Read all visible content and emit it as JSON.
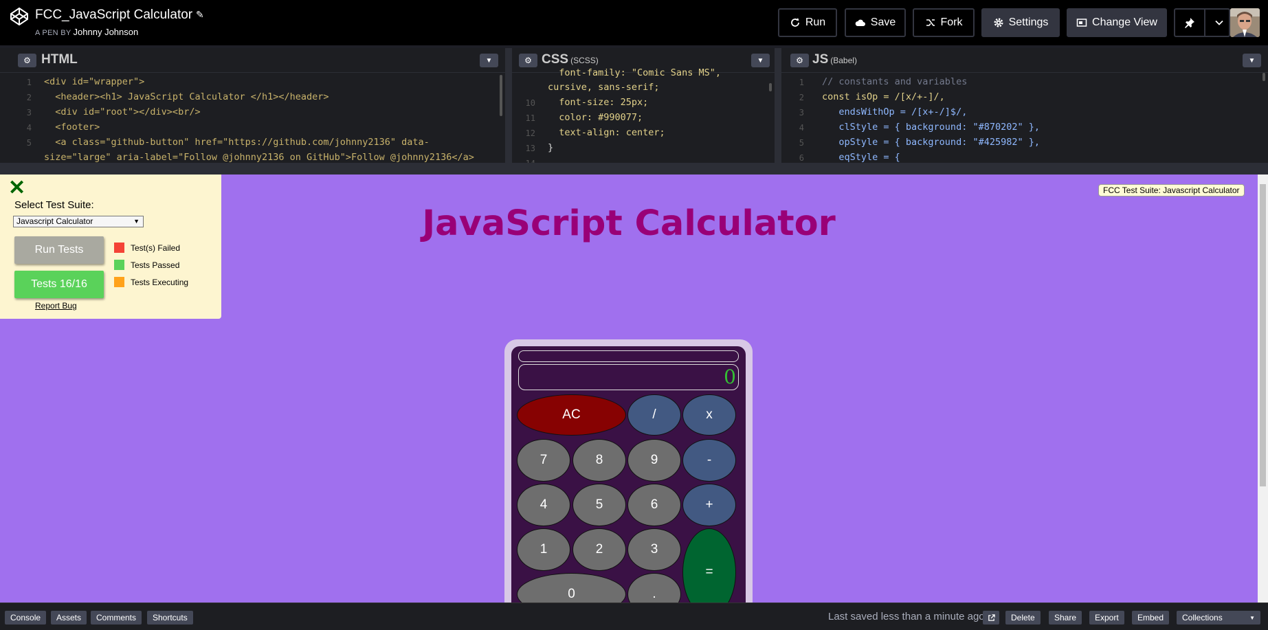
{
  "header": {
    "pen_title": "FCC_JavaScript Calculator",
    "pen_by_label": "A PEN BY",
    "author": "Johnny Johnson",
    "buttons": {
      "run": "Run",
      "save": "Save",
      "fork": "Fork",
      "settings": "Settings",
      "change_view": "Change View"
    }
  },
  "editors": {
    "html": {
      "title": "HTML",
      "subtitle": ""
    },
    "css": {
      "title": "CSS",
      "subtitle": "(SCSS)"
    },
    "js": {
      "title": "JS",
      "subtitle": "(Babel)"
    }
  },
  "code": {
    "html_lines": [
      {
        "n": "1",
        "text": "<div id=\"wrapper\">"
      },
      {
        "n": "2",
        "text": "  <header><h1> JavaScript Calculator </h1></header>"
      },
      {
        "n": "3",
        "text": "  <div id=\"root\"></div><br/>"
      },
      {
        "n": "4",
        "text": "  <footer>"
      },
      {
        "n": "5",
        "text": "  <a class=\"github-button\" href=\"https://github.com/johnny2136\" data-"
      },
      {
        "n": "",
        "text": "size=\"large\" aria-label=\"Follow @johnny2136 on GitHub\">Follow @johnny2136</a>"
      }
    ],
    "css_lines": [
      {
        "n": "",
        "text": "  font-family: \"Comic Sans MS\","
      },
      {
        "n": "",
        "text": "cursive, sans-serif;"
      },
      {
        "n": "10",
        "text": "  font-size: 25px;"
      },
      {
        "n": "11",
        "text": "  color: #990077;"
      },
      {
        "n": "12",
        "text": "  text-align: center;"
      },
      {
        "n": "13",
        "text": "}"
      },
      {
        "n": "14",
        "text": ""
      }
    ],
    "js_lines": [
      {
        "n": "1",
        "text": "// constants and variables"
      },
      {
        "n": "2",
        "text": "const isOp = /[x/+-]/,"
      },
      {
        "n": "3",
        "text": "   endsWithOp = /[x+-/]$/,"
      },
      {
        "n": "4",
        "text": "   clStyle = { background: \"#870202\" },"
      },
      {
        "n": "5",
        "text": "   opStyle = { background: \"#425982\" },"
      },
      {
        "n": "6",
        "text": "   eqStyle = {"
      }
    ]
  },
  "preview": {
    "app_title": "JavaScript Calculator",
    "fcc_badge": "FCC Test Suite: Javascript Calculator",
    "test_suite": {
      "label": "Select Test Suite:",
      "selected": "Javascript Calculator",
      "run_tests": "Run Tests",
      "tests_result": "Tests 16/16",
      "report_bug": "Report Bug",
      "legend": [
        {
          "label": "Test(s) Failed",
          "color": "#f44336"
        },
        {
          "label": "Tests Passed",
          "color": "#5ad25a"
        },
        {
          "label": "Tests Executing",
          "color": "#ffa21a"
        }
      ]
    },
    "calculator": {
      "formula": "",
      "display": "0",
      "keys": {
        "clear": "AC",
        "divide": "/",
        "multiply": "x",
        "seven": "7",
        "eight": "8",
        "nine": "9",
        "subtract": "-",
        "four": "4",
        "five": "5",
        "six": "6",
        "add": "+",
        "one": "1",
        "two": "2",
        "three": "3",
        "equals": "=",
        "zero": "0",
        "decimal": "."
      }
    }
  },
  "footer": {
    "console": "Console",
    "assets": "Assets",
    "comments": "Comments",
    "shortcuts": "Shortcuts",
    "last_saved": "Last saved less than a minute ago",
    "delete": "Delete",
    "share": "Share",
    "export": "Export",
    "embed": "Embed",
    "collections": "Collections"
  },
  "icons": [
    "codepen-logo-icon",
    "pencil-icon",
    "run-icon",
    "cloud-icon",
    "fork-icon",
    "gear-icon",
    "change-view-icon",
    "pin-icon",
    "chevron-down-icon",
    "close-icon",
    "external-link-icon"
  ]
}
